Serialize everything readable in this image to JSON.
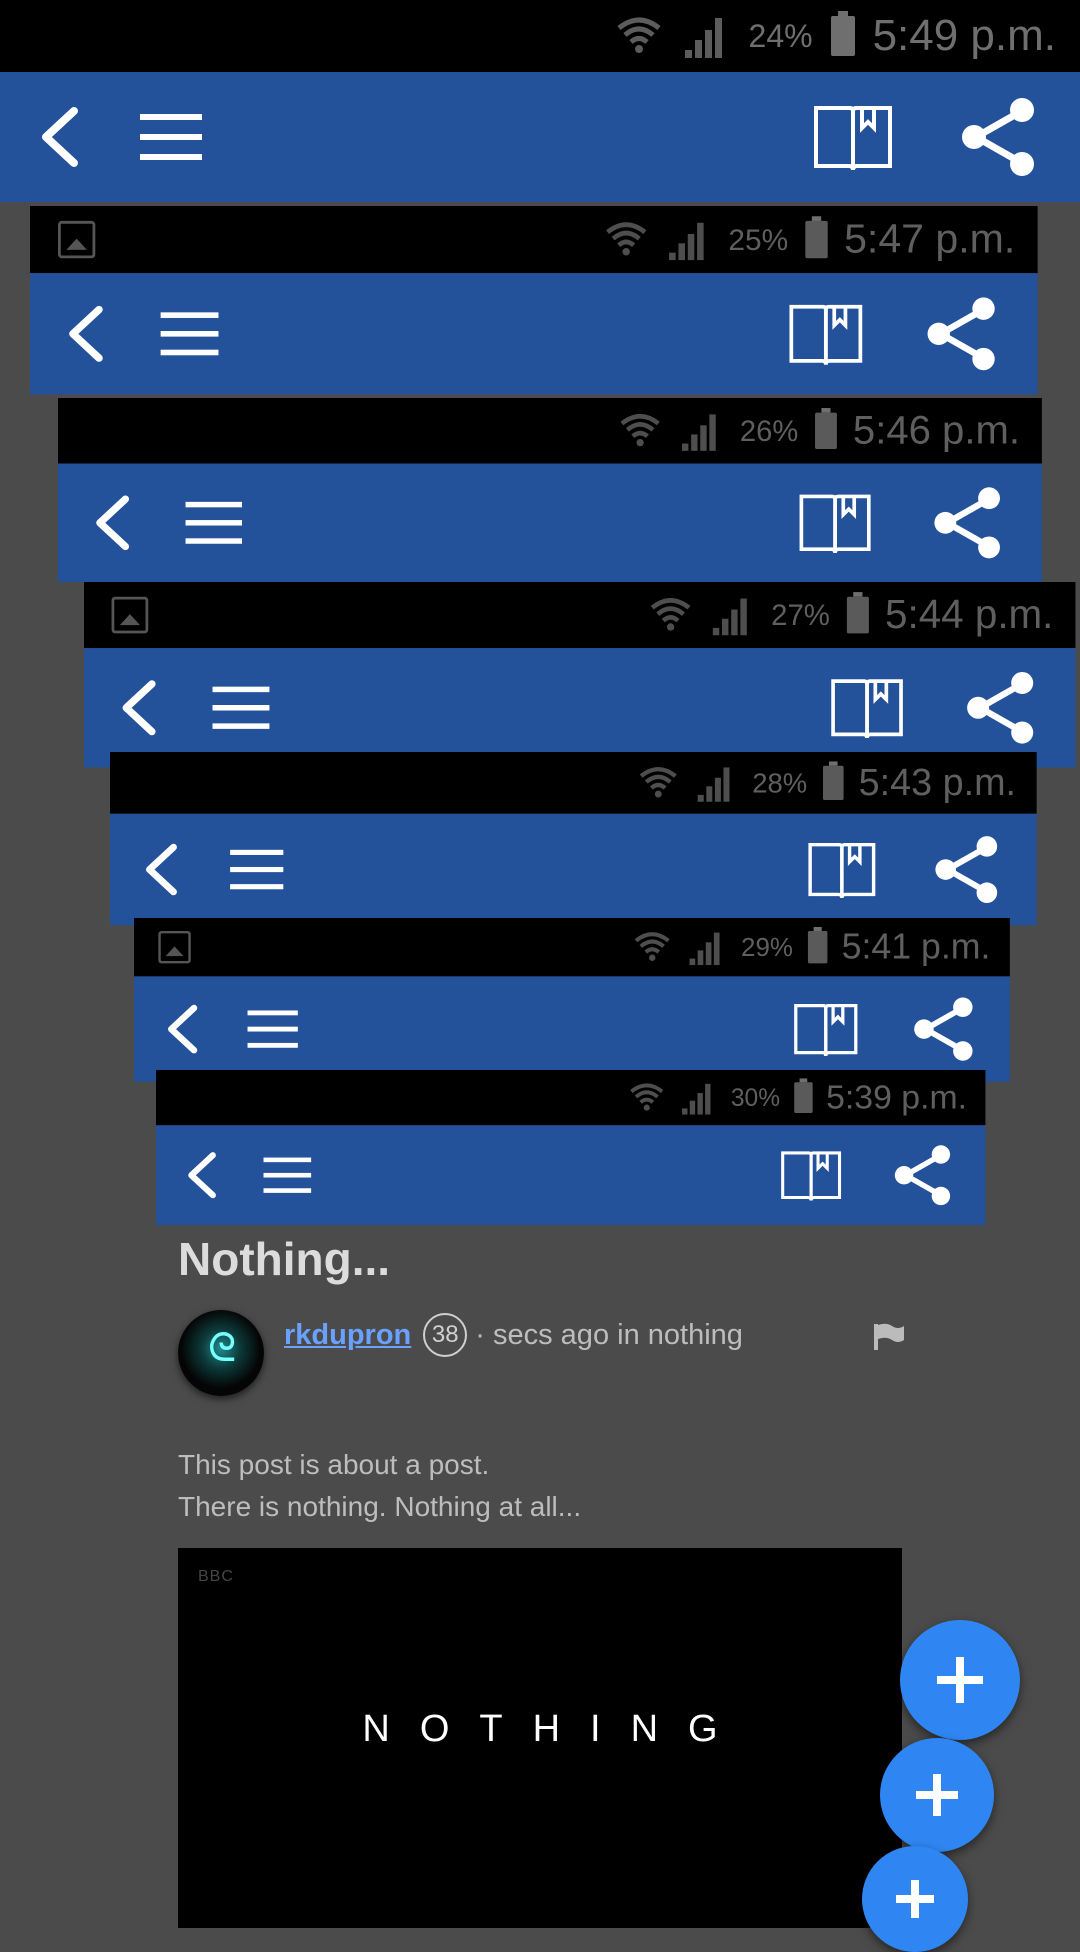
{
  "status_bar": {
    "battery": "24%",
    "time": "5:49 p.m."
  },
  "nested_status_bars": [
    {
      "battery": "25%",
      "time": "5:47 p.m."
    },
    {
      "battery": "26%",
      "time": "5:46 p.m."
    },
    {
      "battery": "27%",
      "time": "5:44 p.m."
    },
    {
      "battery": "28%",
      "time": "5:43 p.m."
    },
    {
      "battery": "29%",
      "time": "5:41 p.m."
    },
    {
      "battery": "30%",
      "time": "5:39 p.m."
    }
  ],
  "toolbar": {
    "icons": [
      "back-icon",
      "menu-icon",
      "bookmark-book-icon",
      "share-icon"
    ],
    "color": "#23519a"
  },
  "post": {
    "title": "Nothing...",
    "author": "rkdupron",
    "reputation": "38",
    "meta": "· secs ago in nothing",
    "body_lines": [
      "This post is about a post.",
      "There is nothing. Nothing at all..."
    ],
    "media_logo": "BBC",
    "media_text": "NOTHING"
  },
  "fabs": [
    "plus-icon",
    "plus-icon",
    "plus-icon"
  ]
}
